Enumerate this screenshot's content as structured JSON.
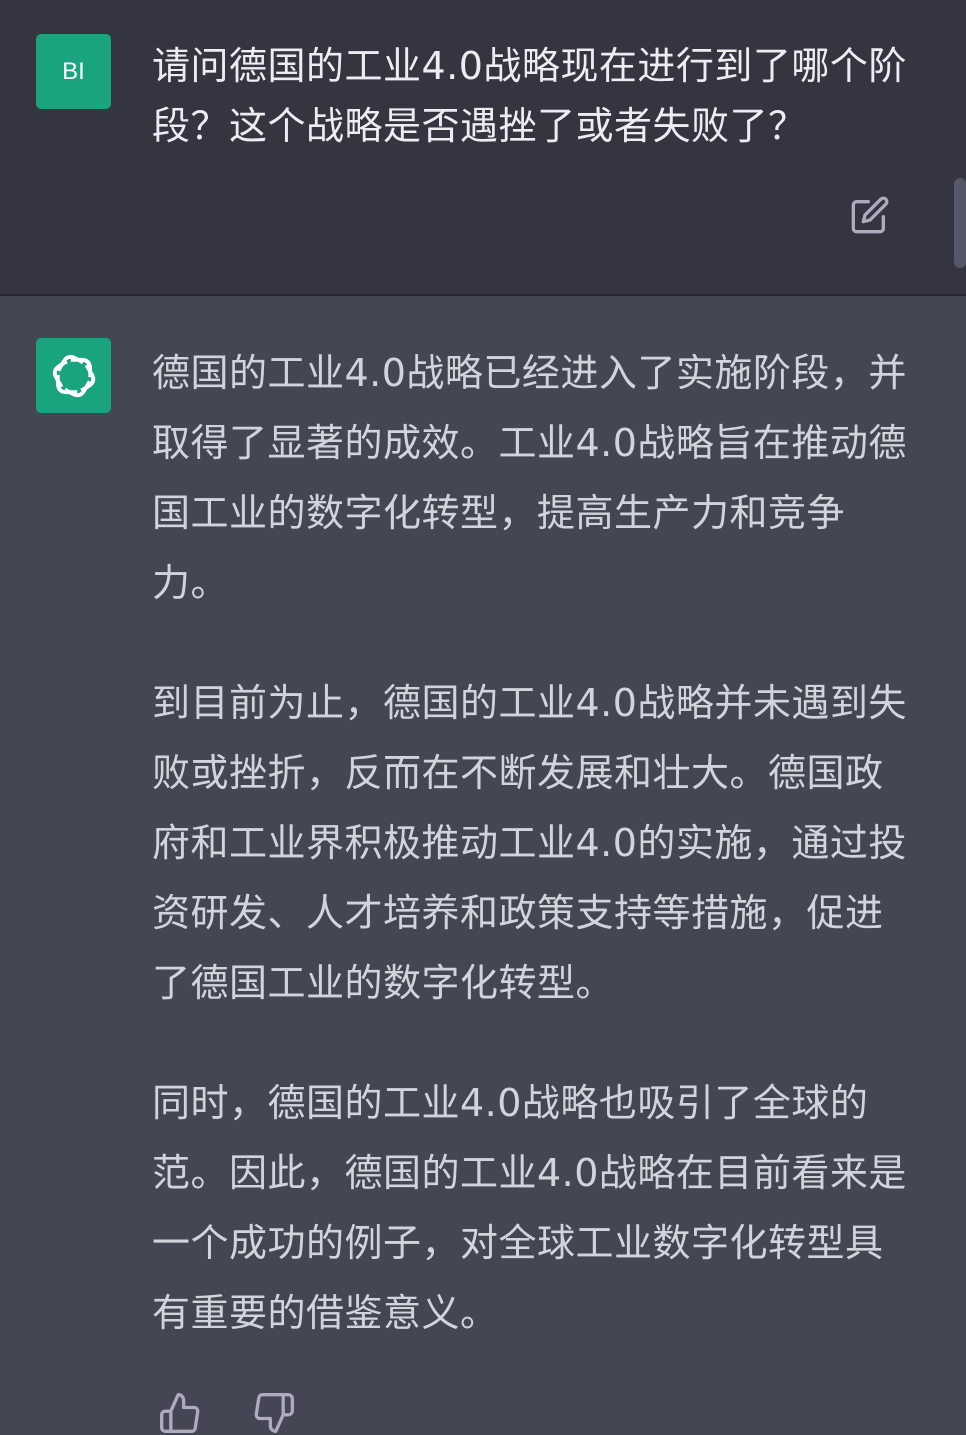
{
  "user_message": {
    "avatar_initials": "BI",
    "text": "请问德国的工业4.0战略现在进行到了哪个阶段？这个战略是否遇挫了或者失败了？"
  },
  "assistant_message": {
    "paragraphs": [
      "德国的工业4.0战略已经进入了实施阶段，并取得了显著的成效。工业4.0战略旨在推动德国工业的数字化转型，提高生产力和竞争力。",
      "到目前为止，德国的工业4.0战略并未遇到失败或挫折，反而在不断发展和壮大。德国政府和工业界积极推动工业4.0的实施，通过投资研发、人才培养和政策支持等措施，促进了德国工业的数字化转型。",
      "同时，德国的工业4.0战略也吸引了全球的范。因此，德国的工业4.0战略在目前看来是一个成功的例子，对全球工业数字化转型具有重要的借鉴意义。"
    ]
  },
  "icons": {
    "edit": "edit-icon",
    "assistant_logo": "openai-logo-icon",
    "thumbs_up": "thumbs-up-icon",
    "thumbs_down": "thumbs-down-icon"
  },
  "colors": {
    "user_bg": "#343541",
    "assistant_bg": "#444654",
    "avatar_bg": "#19a37f",
    "text": "#d1d5db"
  }
}
